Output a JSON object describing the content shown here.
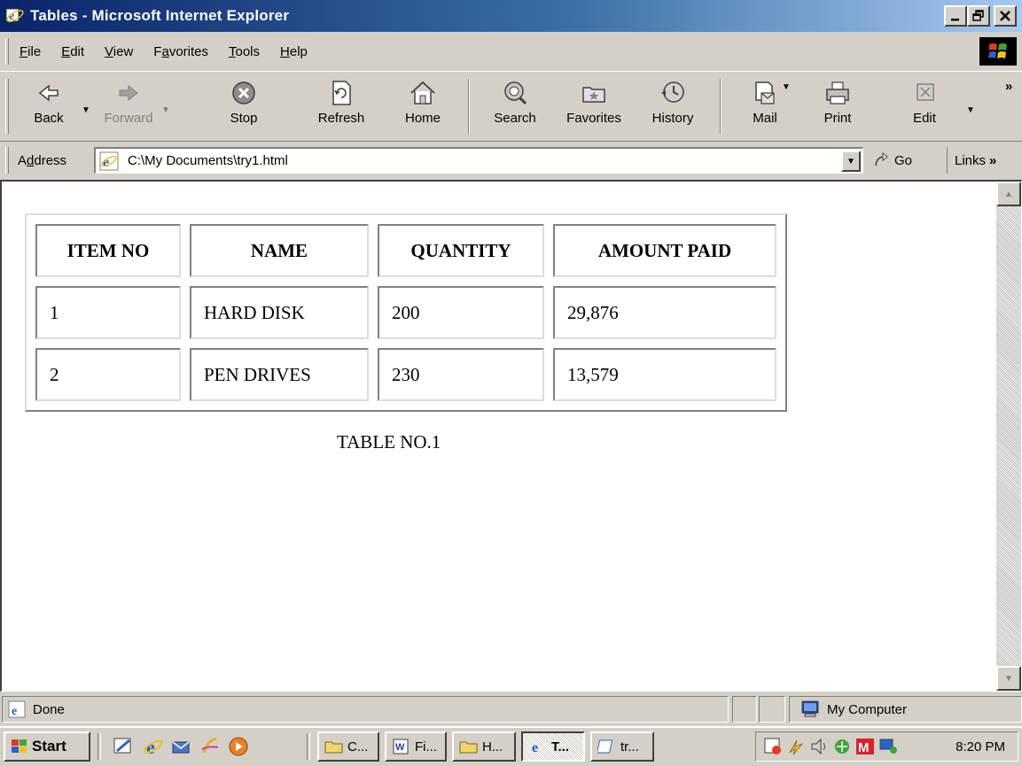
{
  "window": {
    "title": "Tables - Microsoft Internet Explorer"
  },
  "menu": {
    "items": [
      "File",
      "Edit",
      "View",
      "Favorites",
      "Tools",
      "Help"
    ],
    "mnemonics": [
      "F",
      "E",
      "V",
      "a",
      "T",
      "H"
    ]
  },
  "toolbar": {
    "back": "Back",
    "forward": "Forward",
    "stop": "Stop",
    "refresh": "Refresh",
    "home": "Home",
    "search": "Search",
    "favorites": "Favorites",
    "history": "History",
    "mail": "Mail",
    "print": "Print",
    "edit": "Edit",
    "more": "»"
  },
  "address": {
    "label": "Address",
    "url": "C:\\My Documents\\try1.html",
    "go": "Go",
    "links": "Links"
  },
  "page": {
    "table": {
      "headers": [
        "ITEM NO",
        "NAME",
        "QUANTITY",
        "AMOUNT PAID"
      ],
      "rows": [
        [
          "1",
          "HARD DISK",
          "200",
          "29,876"
        ],
        [
          "2",
          "PEN DRIVES",
          "230",
          "13,579"
        ]
      ]
    },
    "caption": "TABLE NO.1"
  },
  "status": {
    "text": "Done",
    "zone": "My Computer"
  },
  "taskbar": {
    "start": "Start",
    "tasks": [
      "C...",
      "Fi...",
      "H...",
      "T...",
      "tr..."
    ],
    "clock": "8:20 PM"
  },
  "colors": {
    "titlebar_start": "#0a246a",
    "titlebar_end": "#a6caf0",
    "chrome": "#d4d0c8"
  }
}
